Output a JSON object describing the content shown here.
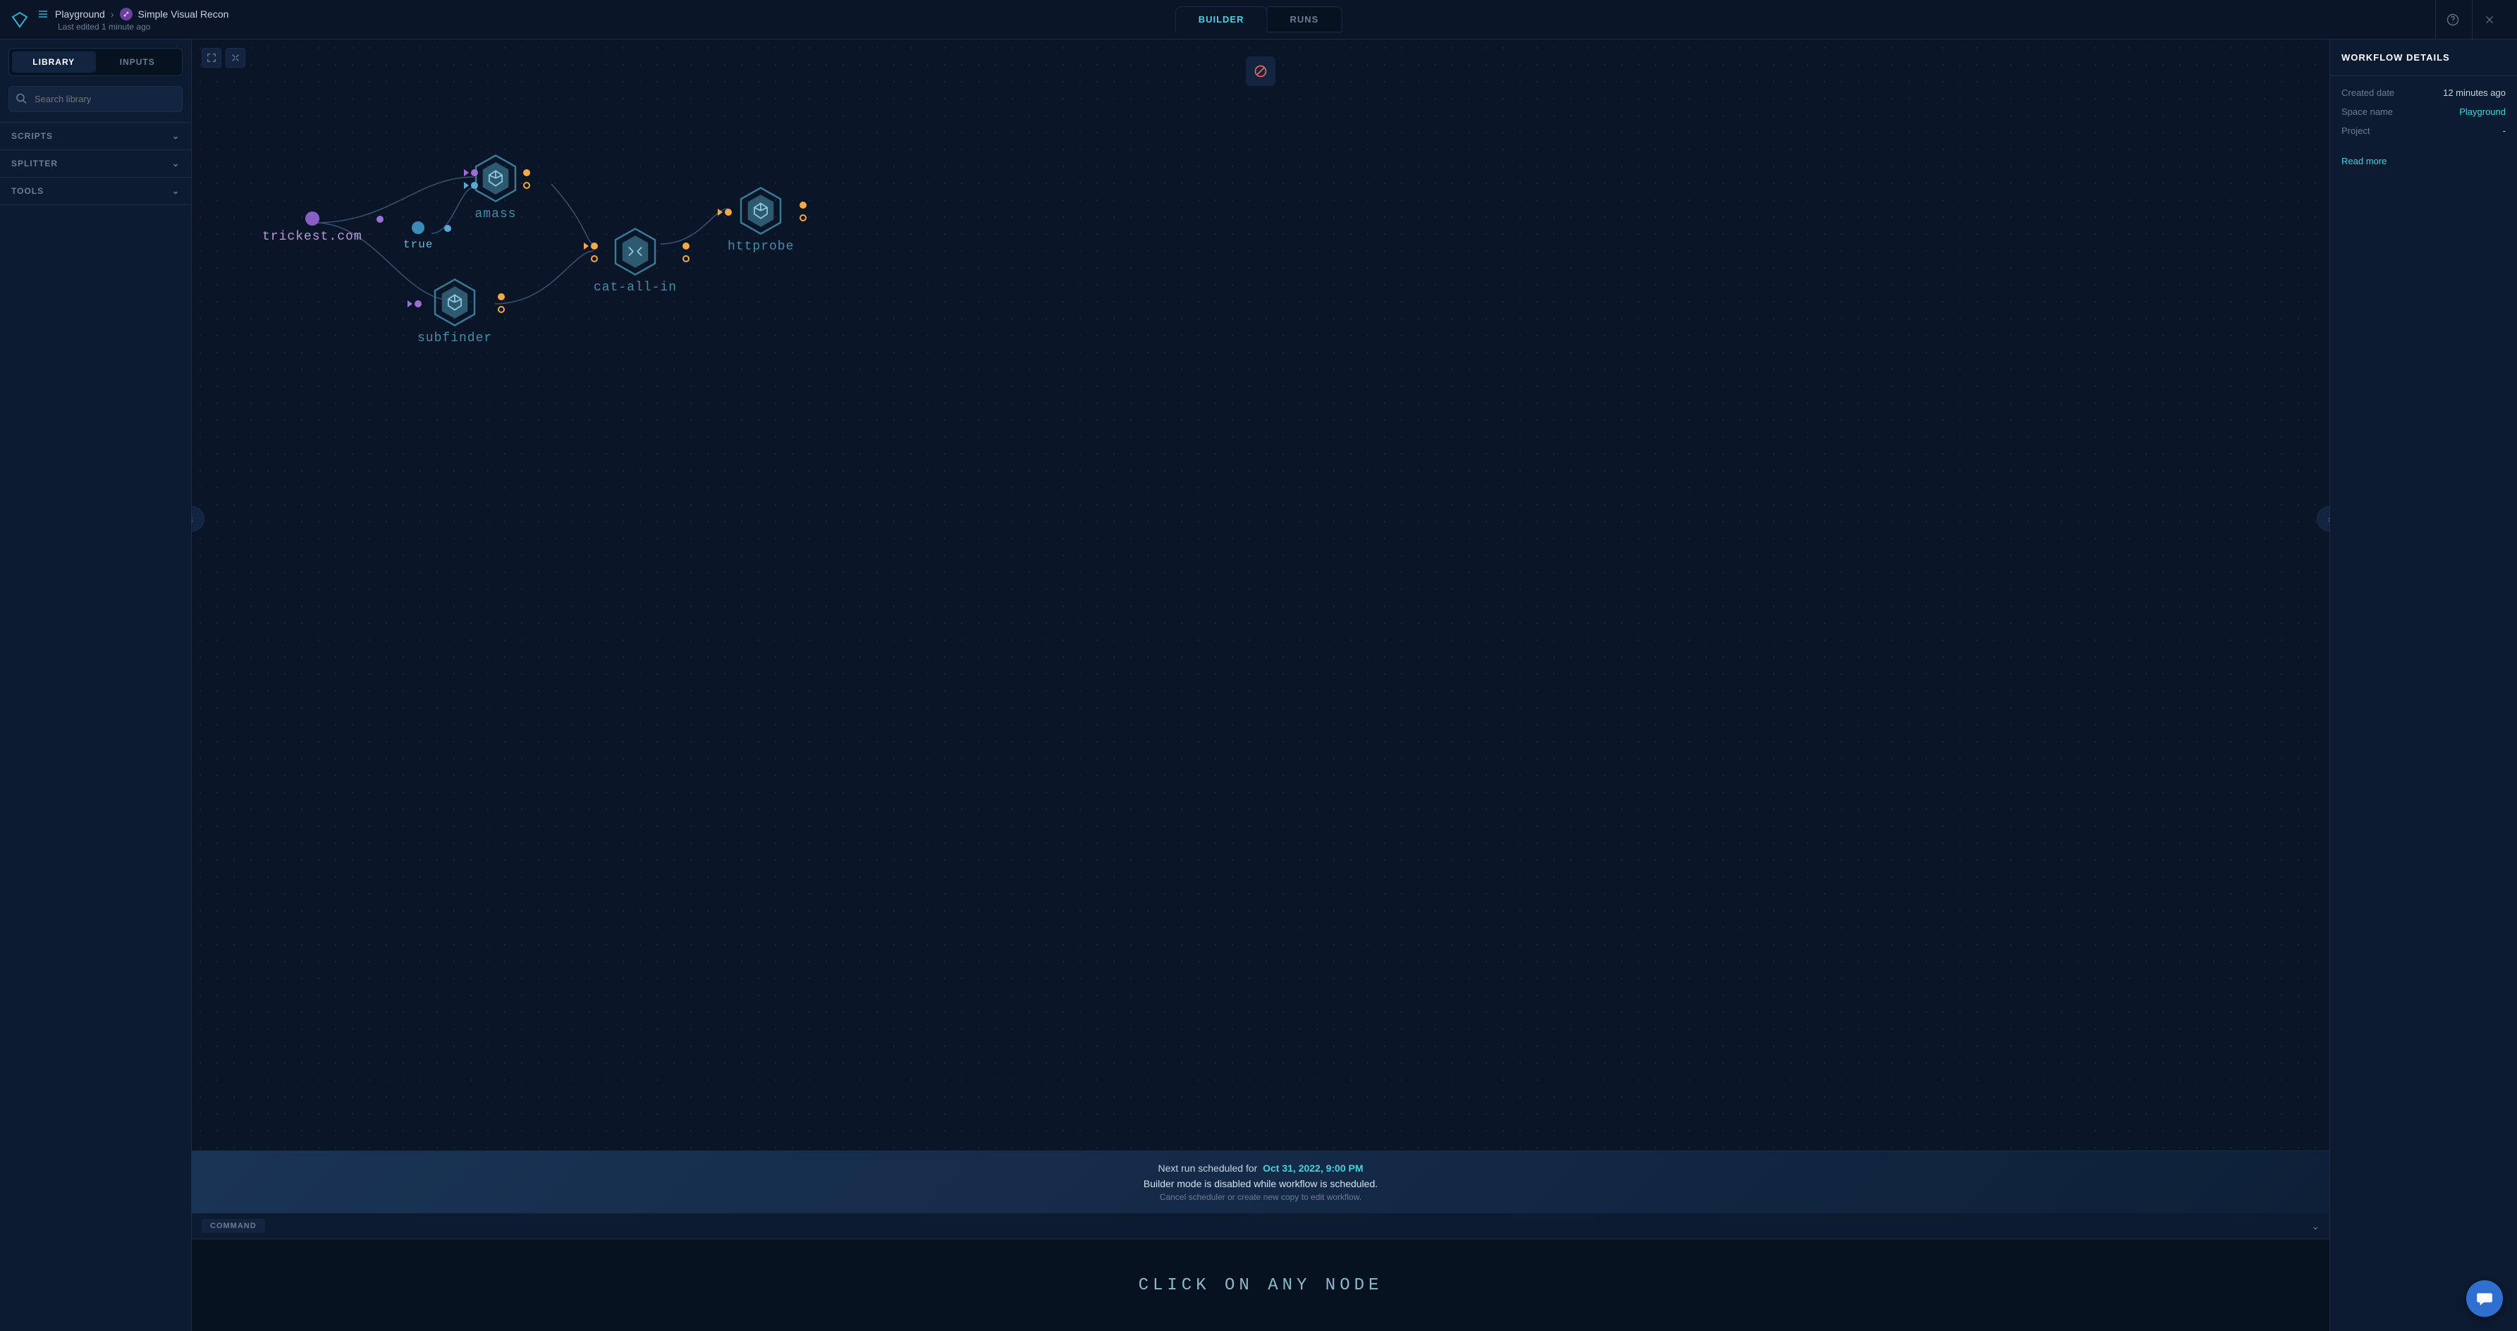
{
  "header": {
    "breadcrumb": {
      "space": "Playground",
      "workflow": "Simple Visual Recon"
    },
    "lastEdited": "Last edited 1 minute ago",
    "tabs": {
      "builder": "BUILDER",
      "runs": "RUNS"
    }
  },
  "sidebarLeft": {
    "tabs": {
      "library": "LIBRARY",
      "inputs": "INPUTS"
    },
    "searchPlaceholder": "Search library",
    "sections": {
      "scripts": "SCRIPTS",
      "splitter": "SPLITTER",
      "tools": "TOOLS"
    }
  },
  "graph": {
    "nodes": {
      "trickest": {
        "label": "trickest.com"
      },
      "true": {
        "label": "true"
      },
      "amass": {
        "label": "amass"
      },
      "subfinder": {
        "label": "subfinder"
      },
      "catallin": {
        "label": "cat-all-in"
      },
      "httprobe": {
        "label": "httprobe"
      }
    }
  },
  "statusBanner": {
    "nextRunLabel": "Next run scheduled for",
    "nextRunDate": "Oct 31, 2022, 9:00 PM",
    "disabledMsg": "Builder mode is disabled while workflow is scheduled.",
    "hintMsg": "Cancel scheduler or create new copy to edit workflow."
  },
  "commandPanel": {
    "label": "COMMAND",
    "placeholder": "CLICK ON ANY NODE"
  },
  "details": {
    "title": "WORKFLOW DETAILS",
    "createdLabel": "Created date",
    "createdValue": "12 minutes ago",
    "spaceLabel": "Space name",
    "spaceValue": "Playground",
    "projectLabel": "Project",
    "projectValue": "-",
    "readMore": "Read more"
  }
}
